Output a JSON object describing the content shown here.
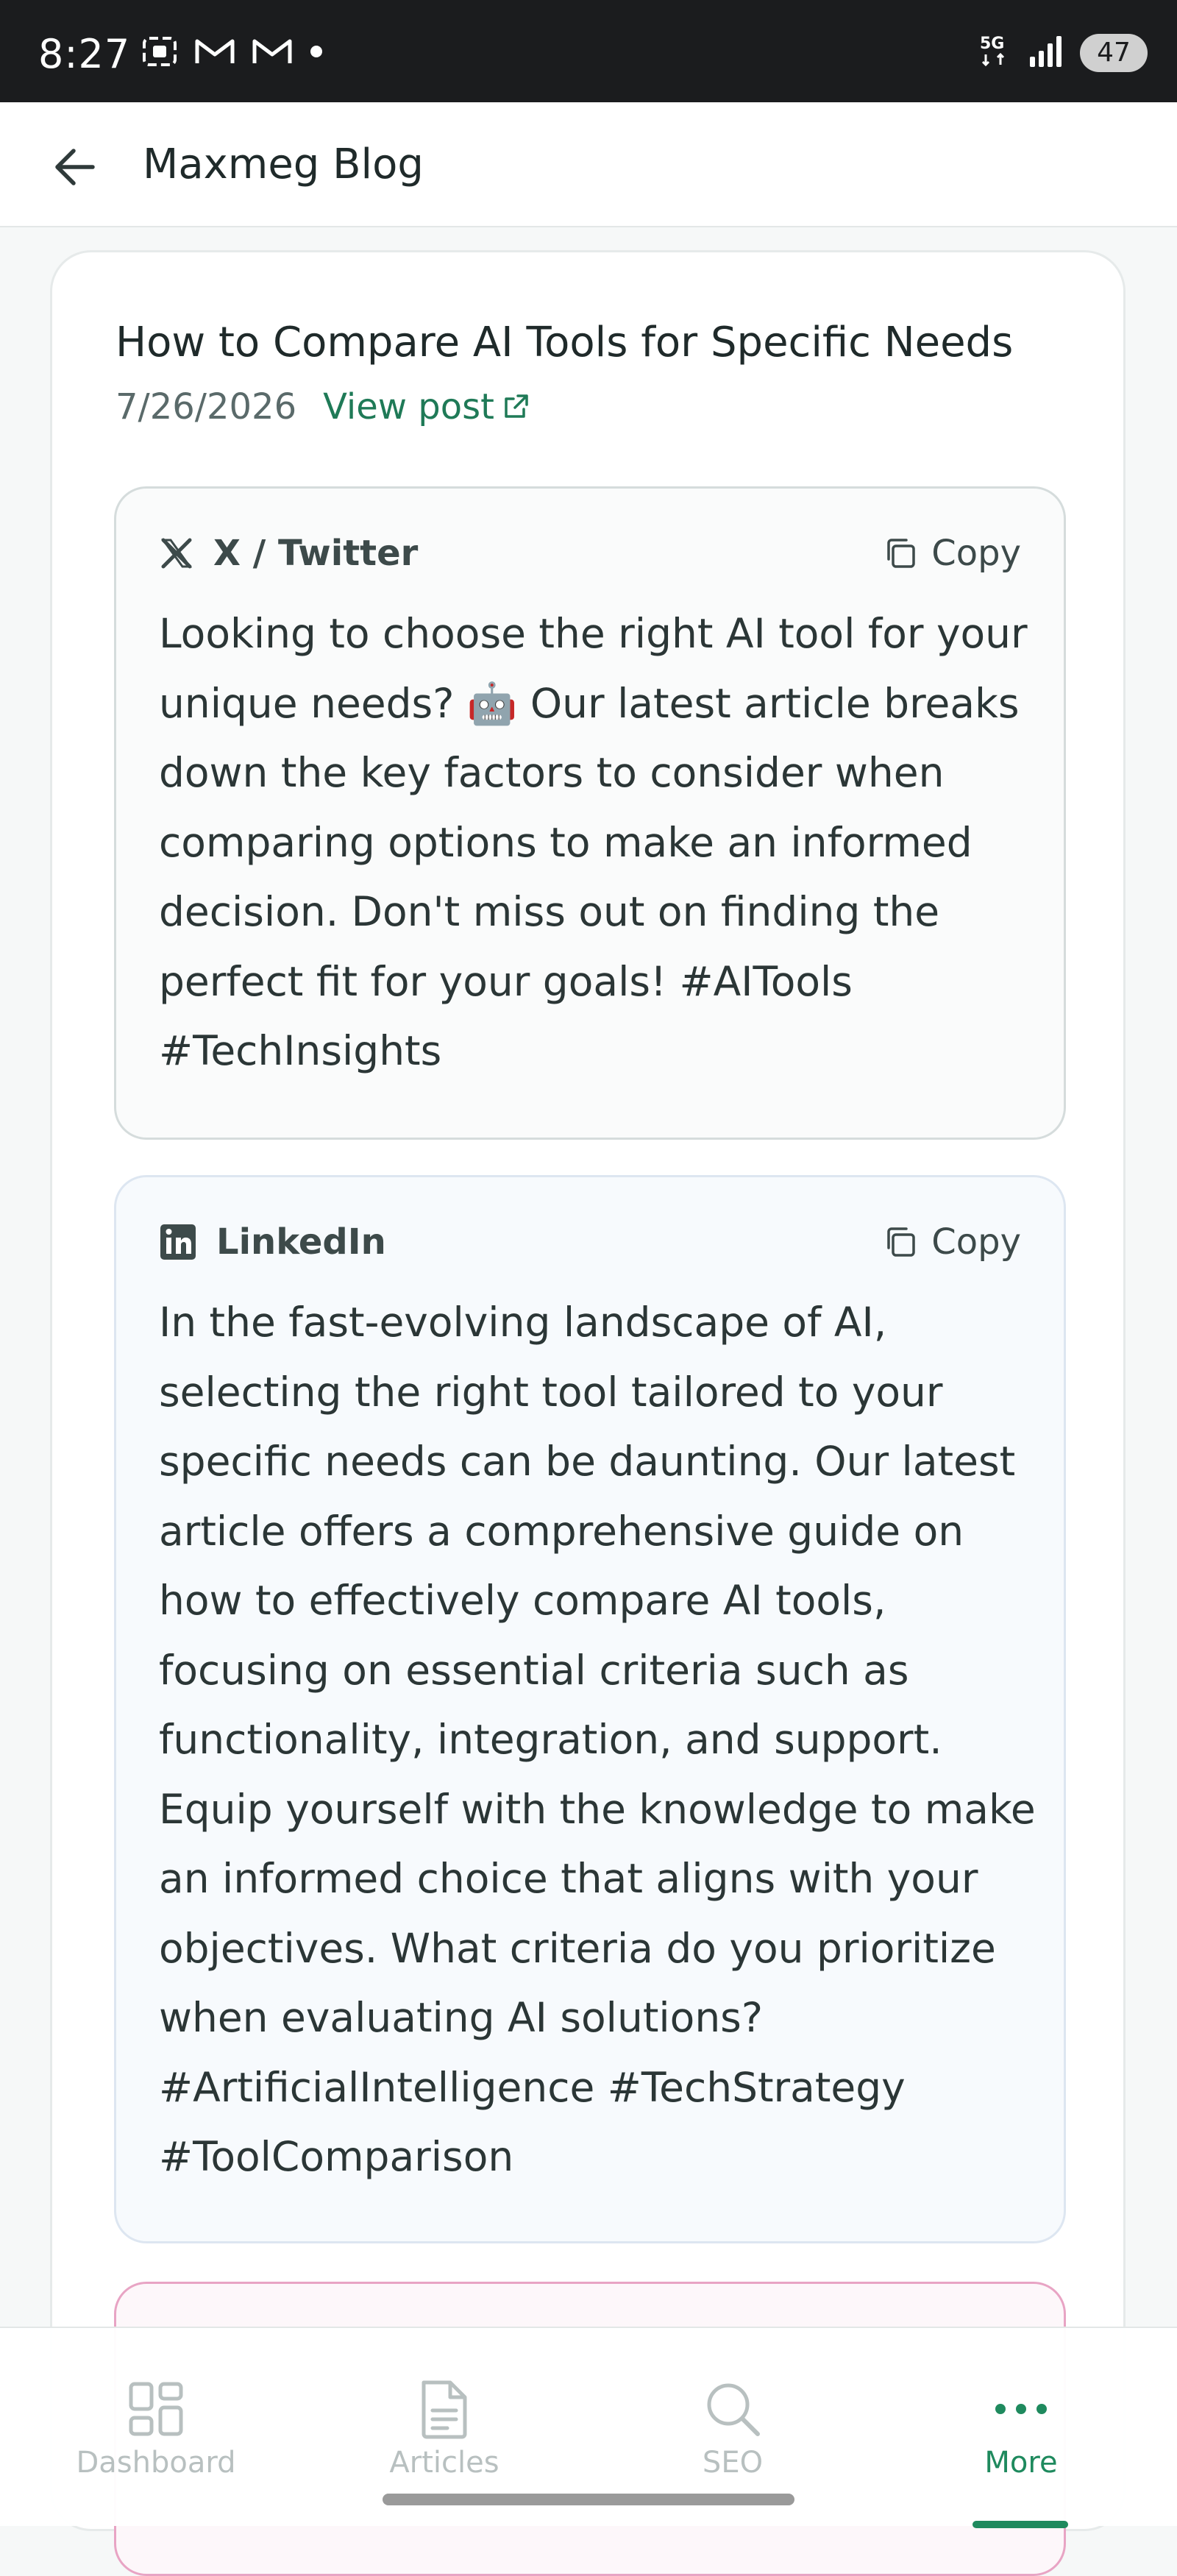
{
  "status_bar": {
    "time": "8:27",
    "network": "5G",
    "battery": "47"
  },
  "app_bar": {
    "title": "Maxmeg Blog"
  },
  "post": {
    "title": "How to Compare AI Tools for Specific Needs",
    "date": "7/26/2026",
    "view_post_label": "View post"
  },
  "socials": {
    "twitter": {
      "name": "X / Twitter",
      "copy_label": "Copy",
      "text": "Looking to choose the right AI tool for your unique needs? 🤖 Our latest article breaks down the key factors to consider when comparing options to make an informed decision. Don't miss out on finding the perfect fit for your goals! #AITools #TechInsights"
    },
    "linkedin": {
      "name": "LinkedIn",
      "copy_label": "Copy",
      "text": "In the fast-evolving landscape of AI, selecting the right tool tailored to your specific needs can be daunting. Our latest article offers a comprehensive guide on how to effectively compare AI tools, focusing on essential criteria such as functionality, integration, and support. Equip yourself with the knowledge to make an informed choice that aligns with your objectives. What criteria do you prioritize when evaluating AI solutions? #ArtificialIntelligence #TechStrategy #ToolComparison"
    }
  },
  "bottom_nav": {
    "items": [
      {
        "label": "Dashboard",
        "icon": "dashboard-icon"
      },
      {
        "label": "Articles",
        "icon": "document-icon"
      },
      {
        "label": "SEO",
        "icon": "search-icon"
      },
      {
        "label": "More",
        "icon": "more-icon"
      }
    ],
    "active": "More"
  },
  "colors": {
    "accent": "#1f8a5e",
    "status_bar_bg": "#1b1c1e"
  }
}
